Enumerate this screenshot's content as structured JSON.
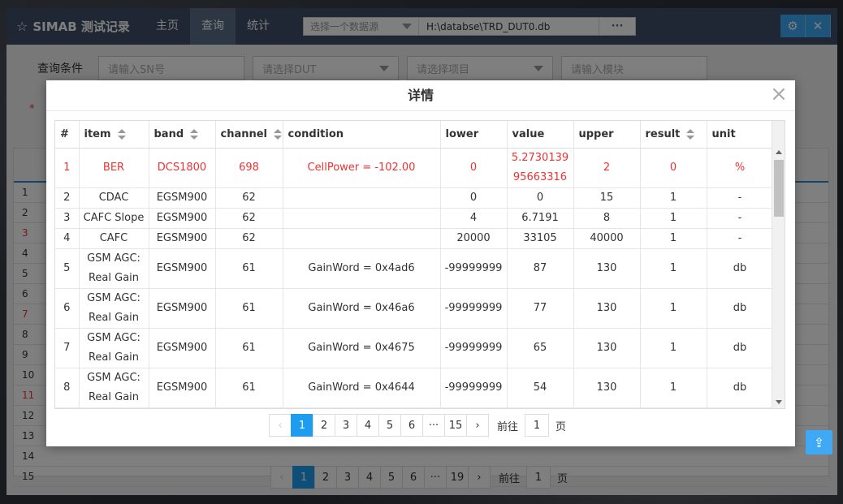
{
  "app": {
    "title": "SIMAB 测试记录",
    "nav": [
      "主页",
      "查询",
      "统计"
    ],
    "active_nav": "查询",
    "datasource_placeholder": "选择一个数据源",
    "datasource_path": "H:\\databse\\TRD_DUT0.db",
    "more_label": "···"
  },
  "query": {
    "label": "查询条件",
    "sn_placeholder": "请输入SN号",
    "dut_placeholder": "请选择DUT",
    "item_placeholder": "请选择项目",
    "module_placeholder": "请输入模块"
  },
  "dialog": {
    "title": "详情",
    "columns": [
      "#",
      "item",
      "band",
      "channel",
      "condition",
      "lower",
      "value",
      "upper",
      "result",
      "unit"
    ],
    "rows": [
      {
        "n": "1",
        "item": "BER",
        "band": "DCS1800",
        "channel": "698",
        "condition": "CellPower = -102.00",
        "lower": "0",
        "value": "5.273013995663316",
        "upper": "2",
        "result": "0",
        "unit": "%",
        "fail": true
      },
      {
        "n": "2",
        "item": "CDAC",
        "band": "EGSM900",
        "channel": "62",
        "condition": "",
        "lower": "0",
        "value": "0",
        "upper": "15",
        "result": "1",
        "unit": "-",
        "fail": false
      },
      {
        "n": "3",
        "item": "CAFC Slope",
        "band": "EGSM900",
        "channel": "62",
        "condition": "",
        "lower": "4",
        "value": "6.7191",
        "upper": "8",
        "result": "1",
        "unit": "-",
        "fail": false
      },
      {
        "n": "4",
        "item": "CAFC",
        "band": "EGSM900",
        "channel": "62",
        "condition": "",
        "lower": "20000",
        "value": "33105",
        "upper": "40000",
        "result": "1",
        "unit": "-",
        "fail": false
      },
      {
        "n": "5",
        "item": "GSM AGC: Real Gain",
        "band": "EGSM900",
        "channel": "61",
        "condition": "GainWord = 0x4ad6",
        "lower": "-99999999",
        "value": "87",
        "upper": "130",
        "result": "1",
        "unit": "db",
        "fail": false
      },
      {
        "n": "6",
        "item": "GSM AGC: Real Gain",
        "band": "EGSM900",
        "channel": "61",
        "condition": "GainWord = 0x46a6",
        "lower": "-99999999",
        "value": "77",
        "upper": "130",
        "result": "1",
        "unit": "db",
        "fail": false
      },
      {
        "n": "7",
        "item": "GSM AGC: Real Gain",
        "band": "EGSM900",
        "channel": "61",
        "condition": "GainWord = 0x4675",
        "lower": "-99999999",
        "value": "65",
        "upper": "130",
        "result": "1",
        "unit": "db",
        "fail": false
      },
      {
        "n": "8",
        "item": "GSM AGC: Real Gain",
        "band": "EGSM900",
        "channel": "61",
        "condition": "GainWord = 0x4644",
        "lower": "-99999999",
        "value": "54",
        "upper": "130",
        "result": "1",
        "unit": "db",
        "fail": false
      }
    ],
    "pager": {
      "pages": [
        "1",
        "2",
        "3",
        "4",
        "5",
        "6",
        "···",
        "15"
      ],
      "active": "1",
      "goto_prefix": "前往",
      "goto_value": "1",
      "goto_suffix": "页"
    }
  },
  "background_table": {
    "row_numbers": [
      "1",
      "2",
      "3",
      "4",
      "5",
      "6",
      "7",
      "8",
      "9",
      "10",
      "11",
      "12",
      "13",
      "14",
      "15"
    ],
    "red_rows": [
      "3",
      "7",
      "11"
    ],
    "pager": {
      "pages": [
        "1",
        "2",
        "3",
        "4",
        "5",
        "6",
        "···",
        "19"
      ],
      "goto_prefix": "前往",
      "goto_value": "1",
      "goto_suffix": "页"
    }
  },
  "colors": {
    "accent": "#1e9cf0",
    "titlebar": "#3d4f66",
    "fail_text": "#e33333"
  }
}
